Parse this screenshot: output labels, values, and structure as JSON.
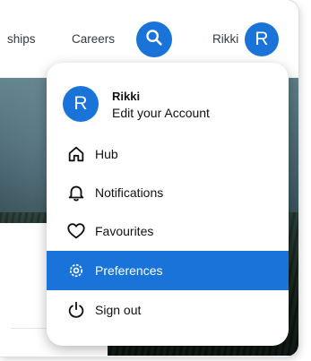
{
  "nav": {
    "links": [
      {
        "label": "ships"
      },
      {
        "label": "Careers"
      }
    ],
    "search_icon": "search-icon",
    "user_name": "Rikki",
    "avatar_initial": "R"
  },
  "menu": {
    "header": {
      "avatar_initial": "R",
      "name": "Rikki",
      "subtitle": "Edit your Account"
    },
    "items": [
      {
        "label": "Hub",
        "icon": "home-icon",
        "active": false
      },
      {
        "label": "Notifications",
        "icon": "bell-icon",
        "active": false
      },
      {
        "label": "Favourites",
        "icon": "heart-icon",
        "active": false
      },
      {
        "label": "Preferences",
        "icon": "gear-icon",
        "active": true
      },
      {
        "label": "Sign out",
        "icon": "power-icon",
        "active": false
      }
    ]
  },
  "colors": {
    "accent": "#1a73d9",
    "text": "#111111",
    "nav_text": "#333a40"
  }
}
